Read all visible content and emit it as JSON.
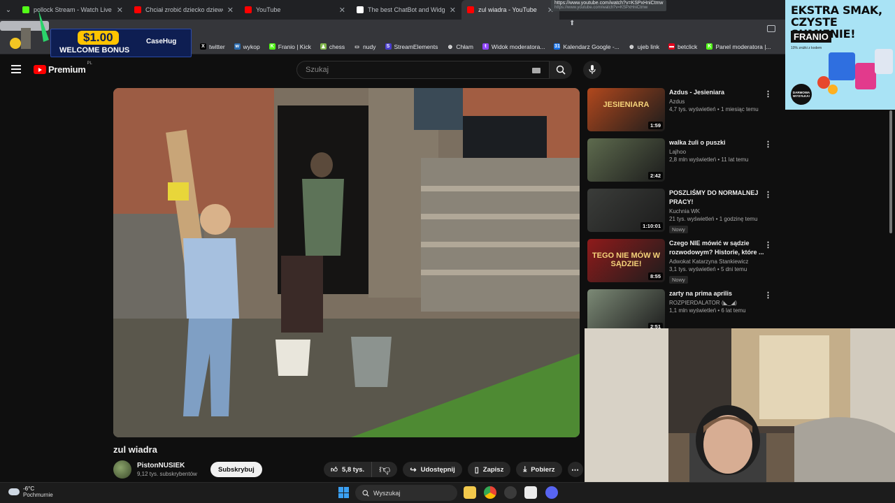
{
  "browser": {
    "tabs": [
      {
        "title": "pollock Stream - Watch Live on",
        "icon_color": "#53fc18",
        "active": false
      },
      {
        "title": "Chciał zrobić dziecko dziewczyn",
        "icon_color": "#ff0000",
        "active": false
      },
      {
        "title": "YouTube",
        "icon_color": "#ff0000",
        "active": false
      },
      {
        "title": "The best ChatBot and Widgets",
        "icon_color": "#ffffff",
        "active": false
      },
      {
        "title": "zul wiadra - YouTube",
        "icon_color": "#ff0000",
        "active": true
      }
    ],
    "tooltip": {
      "line1": "https://www.youtube.com/watch?v=KSPxHniCtmw",
      "line2": "https://www.youtube.com/watch?v=KSPxHniCtmw"
    },
    "bookmarks": [
      {
        "label": "twitter",
        "icon": "x-icon",
        "color": "#000000",
        "glyph": "X"
      },
      {
        "label": "wykop",
        "icon": "wykop-icon",
        "color": "#2b6cb0",
        "glyph": "w"
      },
      {
        "label": "Franio | Kick",
        "icon": "kick-icon",
        "color": "#53fc18",
        "glyph": "K"
      },
      {
        "label": "chess",
        "icon": "chess-icon",
        "color": "#81b64c",
        "glyph": "♟"
      },
      {
        "label": "nudy",
        "icon": "folder-icon",
        "color": "#35363a",
        "glyph": "▭"
      },
      {
        "label": "StreamElements",
        "icon": "streamelements-icon",
        "color": "#4b3fd1",
        "glyph": "S"
      },
      {
        "label": "Chłam",
        "icon": "globe-icon",
        "color": "#35363a",
        "glyph": "◍"
      },
      {
        "label": "Widok moderatora...",
        "icon": "twitch-icon",
        "color": "#9146ff",
        "glyph": "t"
      },
      {
        "label": "Kalendarz Google -...",
        "icon": "calendar-icon",
        "color": "#1a73e8",
        "glyph": "31"
      },
      {
        "label": "ujeb link",
        "icon": "globe-icon",
        "color": "#35363a",
        "glyph": "◍"
      },
      {
        "label": "betclick",
        "icon": "betclic-icon",
        "color": "#e3001b",
        "glyph": "▬"
      },
      {
        "label": "Panel moderatora |...",
        "icon": "kick-icon",
        "color": "#53fc18",
        "glyph": "K"
      }
    ]
  },
  "youtube": {
    "logo_text": "Premium",
    "logo_region": "PL",
    "search_placeholder": "Szukaj",
    "video": {
      "title": "zul wiadra",
      "channel": "PistonNUSIEK",
      "subscribers": "9,12 tys. subskrybentów",
      "subscribe_label": "Subskrybuj",
      "likes": "5,8 tys.",
      "share_label": "Udostępnij",
      "save_label": "Zapisz",
      "download_label": "Pobierz"
    },
    "recommendations": [
      {
        "title": "Azdus - Jesieniara",
        "channel": "Azdus",
        "views": "4,7 tys. wyświetleń • 1 miesiąc temu",
        "duration": "1:59",
        "badge": "",
        "thumb_text": "JESIENIARA",
        "thumb_color": "#b1481d"
      },
      {
        "title": "walka żuli o puszki",
        "channel": "Lajhoo",
        "views": "2,8 mln wyświetleń • 11 lat temu",
        "duration": "2:42",
        "badge": "",
        "thumb_text": "",
        "thumb_color": "#5e6b4e"
      },
      {
        "title": "POSZLIŚMY DO NORMALNEJ PRACY!",
        "channel": "Kuchnia WK",
        "views": "21 tys. wyświetleń • 1 godzinę temu",
        "duration": "1:10:01",
        "badge": "Nowy",
        "thumb_text": "",
        "thumb_color": "#3b3d3a"
      },
      {
        "title": "Czego NIE mówić w sądzie rozwodowym? Historie, które ...",
        "channel": "Adwokat Katarzyna Stankiewicz",
        "views": "3,1 tys. wyświetleń • 5 dni temu",
        "duration": "8:55",
        "badge": "Nowy",
        "thumb_text": "TEGO NIE MÓW W SĄDZIE!",
        "thumb_color": "#8f1b1b"
      },
      {
        "title": "zarty na prima aprilis",
        "channel": "ROZPIERDALATOR (◣_◢)",
        "views": "1,1 mln wyświetleń • 6 lat temu",
        "duration": "2:51",
        "badge": "",
        "thumb_text": "",
        "thumb_color": "#7c8a76"
      }
    ]
  },
  "ads": {
    "left": {
      "amount": "$1.00",
      "text": "WELCOME BONUS",
      "brand": "CaseHug"
    },
    "right": {
      "headline": "EKSTRA SMAK, CZYSTE SUMIENIE!",
      "brand": "FRANIO",
      "sub": "10% zniżki z kodem",
      "badge": "DARMOWA WYSYŁKA!"
    }
  },
  "taskbar": {
    "temperature": "-6°C",
    "weather": "Pochmurnie",
    "search_placeholder": "Wyszukaj"
  }
}
